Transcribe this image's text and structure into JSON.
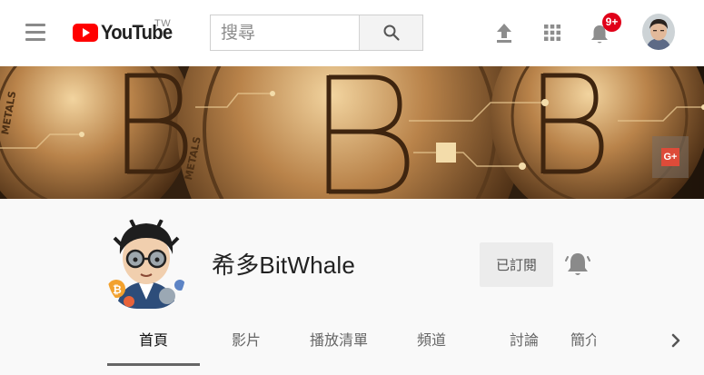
{
  "header": {
    "logo_text": "YouTube",
    "region": "TW",
    "search": {
      "placeholder": "搜尋"
    },
    "notifications": {
      "badge": "9+"
    },
    "icons": [
      "menu-icon",
      "youtube-logo-icon",
      "search-icon",
      "upload-icon",
      "apps-grid-icon",
      "notification-bell-icon",
      "user-avatar"
    ]
  },
  "banner": {
    "social_link_label": "G+"
  },
  "channel": {
    "name": "希多BitWhale",
    "subscribed_label": "已訂閱",
    "bell_icon": "notification-bell-icon"
  },
  "tabs": [
    {
      "label": "首頁",
      "active": true
    },
    {
      "label": "影片",
      "active": false
    },
    {
      "label": "播放清單",
      "active": false
    },
    {
      "label": "頻道",
      "active": false
    },
    {
      "label": "討論",
      "active": false
    },
    {
      "label": "簡介",
      "active": false
    }
  ],
  "colors": {
    "brand_red": "#ff0000",
    "badge_red": "#e00019",
    "active_tab_underline": "#666666"
  }
}
